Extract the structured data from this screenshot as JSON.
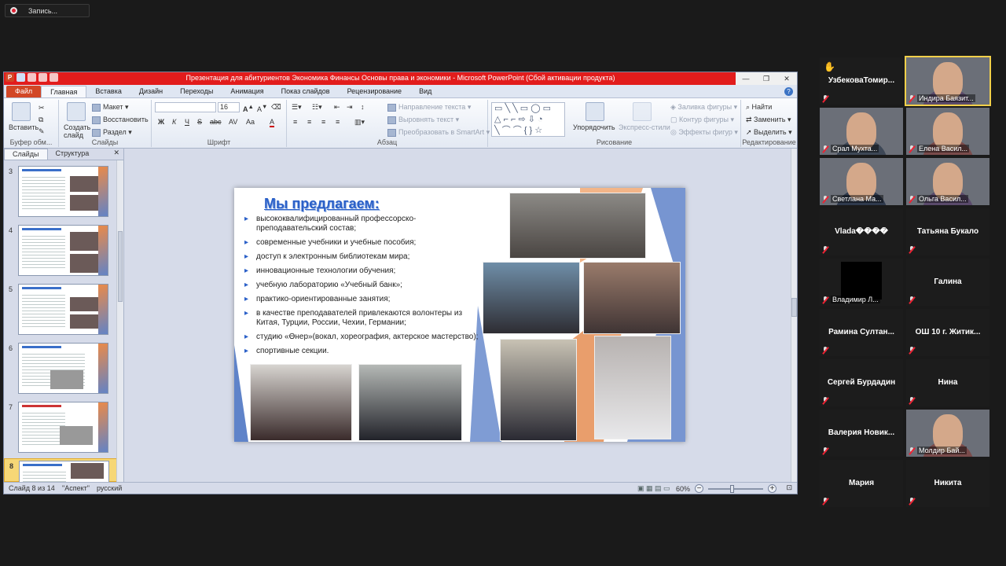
{
  "recording": {
    "label": "Запись..."
  },
  "powerpoint": {
    "title": "Презентация для абитуриентов Экономика Финансы Основы права и экономики  -  Microsoft PowerPoint (Сбой активации продукта)",
    "window_buttons": [
      "—",
      "❐",
      "✕"
    ],
    "tabs": [
      "Файл",
      "Главная",
      "Вставка",
      "Дизайн",
      "Переходы",
      "Анимация",
      "Показ слайдов",
      "Рецензирование",
      "Вид"
    ],
    "active_tab": "Главная",
    "ribbon": {
      "clipboard": {
        "paste": "Вставить",
        "label": "Буфер обм..."
      },
      "slides": {
        "new_slide": "Создать слайд",
        "layout": "Макет",
        "reset": "Восстановить",
        "section": "Раздел",
        "label": "Слайды"
      },
      "font": {
        "size": "16",
        "label": "Шрифт",
        "bold": "Ж",
        "italic": "К",
        "underline": "Ч",
        "strike": "S",
        "abc": "abc",
        "spacing": "AV",
        "case": "Aa",
        "color": "A"
      },
      "paragraph": {
        "text_direction": "Направление текста",
        "align_text": "Выровнять текст",
        "smartart": "Преобразовать в SmartArt",
        "label": "Абзац"
      },
      "drawing": {
        "arrange": "Упорядочить",
        "quick_styles": "Экспресс-стили",
        "shape_fill": "Заливка фигуры",
        "shape_outline": "Контур фигуры",
        "shape_effects": "Эффекты фигур",
        "label": "Рисование"
      },
      "editing": {
        "find": "Найти",
        "replace": "Заменить",
        "select": "Выделить",
        "label": "Редактирование"
      }
    },
    "left_pane": {
      "tabs": [
        "Слайды",
        "Структура"
      ],
      "close": "✕",
      "slide_numbers": [
        "3",
        "4",
        "5",
        "6",
        "7",
        "8"
      ]
    },
    "slide": {
      "title": "Мы предлагаем:",
      "bullets": [
        "высококвалифицированный профессорско-преподавательский состав;",
        "современные учебники и учебные пособия;",
        "доступ к электронным библиотекам мира;",
        "инновационные технологии обучения;",
        "учебную лабораторию «Учебный банк»;",
        "практико-ориентированные занятия;",
        "в качестве преподавателей привлекаются волонтеры из Китая, Турции, России, Чехии, Германии;",
        "студию «Өнер»(вокал, хореография, актерское мастерство);",
        "спортивные секции."
      ]
    },
    "status": {
      "slide_counter": "Слайд 8 из 14",
      "theme": "\"Аспект\"",
      "language": "русский",
      "zoom": "60%",
      "zoom_level_percent": 60
    }
  },
  "participants": [
    {
      "name": "УзбековаТомир...",
      "video": false,
      "hand_raised": true
    },
    {
      "name": "Индира Баязит...",
      "video": true,
      "highlighted": true
    },
    {
      "name": "Срал Мухта...",
      "video": true
    },
    {
      "name": "Елена Васил...",
      "video": true
    },
    {
      "name": "Светлана Ма...",
      "video": true
    },
    {
      "name": "Ольга Васил...",
      "video": true
    },
    {
      "name": "Vlada����",
      "video": false
    },
    {
      "name": "Татьяна Букало",
      "video": false
    },
    {
      "name": "Владимир Л...",
      "video": "black"
    },
    {
      "name": "Галина",
      "video": false
    },
    {
      "name": "Рамина  Султан...",
      "video": false
    },
    {
      "name": "ОШ 10 г. Житик...",
      "video": false
    },
    {
      "name": "Сергей Бурдадин",
      "video": false
    },
    {
      "name": "Нина",
      "video": false
    },
    {
      "name": "Валерия  Новик...",
      "video": false
    },
    {
      "name": "Молдир Бай...",
      "video": true
    },
    {
      "name": "Мария",
      "video": false
    },
    {
      "name": "Никита",
      "video": false
    }
  ],
  "colors": {
    "title_bar": "#e21c1c",
    "file_tab": "#d24726",
    "slide_title": "#2b60c8",
    "selected_thumb": "#f6d776",
    "tile_bg": "#1c1c1c"
  }
}
